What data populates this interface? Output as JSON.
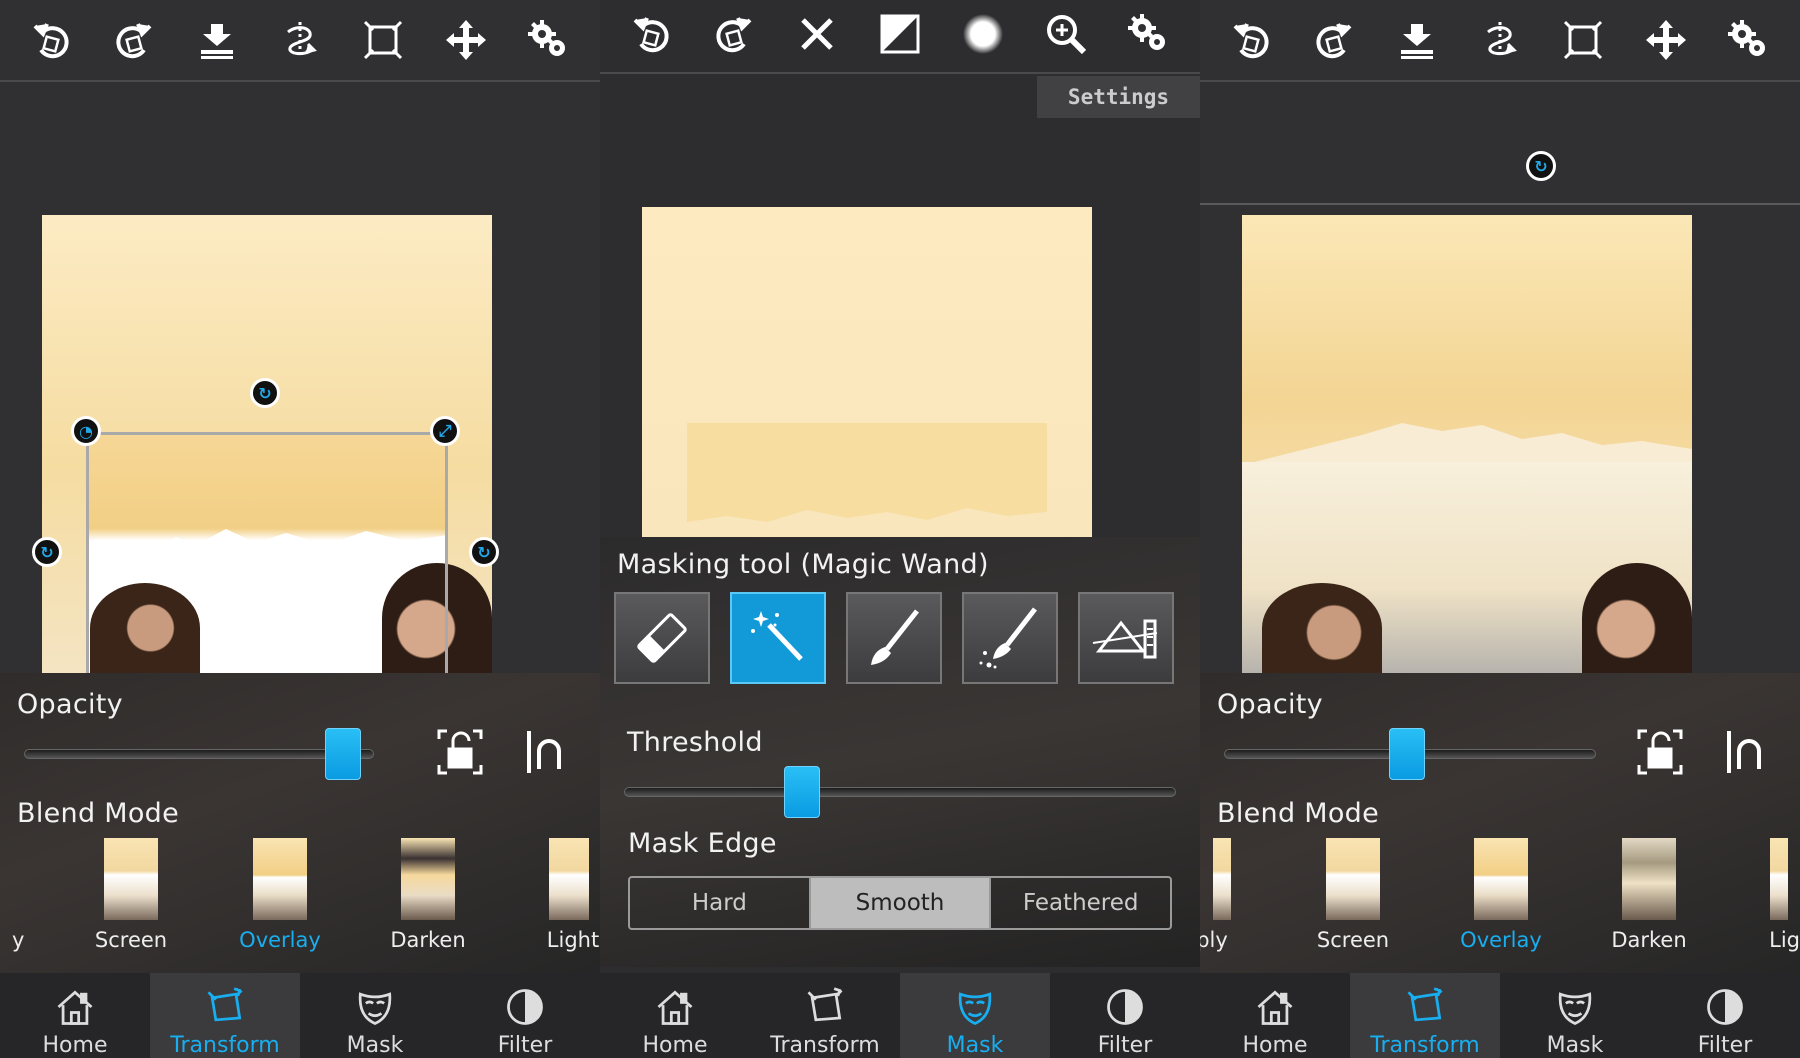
{
  "left": {
    "toolbar": [
      "undo-icon",
      "redo-icon",
      "merge-down-icon",
      "flip-icon",
      "fit-frame-icon",
      "move-icon",
      "settings-icon"
    ],
    "opacity": {
      "label": "Opacity",
      "value": 0.96
    },
    "blend": {
      "label": "Blend Mode",
      "items": [
        {
          "label": "y"
        },
        {
          "label": "Screen"
        },
        {
          "label": "Overlay",
          "selected": true
        },
        {
          "label": "Darken"
        },
        {
          "label": "Light"
        }
      ]
    },
    "tabs": [
      {
        "label": "Home"
      },
      {
        "label": "Transform",
        "active": true
      },
      {
        "label": "Mask"
      },
      {
        "label": "Filter"
      }
    ]
  },
  "middle": {
    "toolbar": [
      "undo-icon",
      "redo-icon",
      "clear-mask-icon",
      "invert-mask-icon",
      "brush-softness-icon",
      "zoom-icon",
      "settings-icon"
    ],
    "settings_label": "Settings",
    "masking_tool_title": "Masking tool (Magic Wand)",
    "tools": [
      "eraser-tool",
      "magic-wand-tool",
      "brush-tool",
      "spray-brush-tool",
      "gradient-tool"
    ],
    "active_tool": "magic-wand-tool",
    "threshold": {
      "label": "Threshold",
      "value": 0.31
    },
    "mask_edge": {
      "label": "Mask Edge",
      "options": [
        "Hard",
        "Smooth",
        "Feathered"
      ],
      "selected": "Smooth"
    },
    "tabs": [
      {
        "label": "Home"
      },
      {
        "label": "Transform"
      },
      {
        "label": "Mask",
        "active": true
      },
      {
        "label": "Filter"
      }
    ]
  },
  "right": {
    "toolbar": [
      "undo-icon",
      "redo-icon",
      "merge-down-icon",
      "flip-icon",
      "fit-frame-icon",
      "move-icon",
      "settings-icon"
    ],
    "opacity": {
      "label": "Opacity",
      "value": 0.49
    },
    "blend": {
      "label": "Blend Mode",
      "items": [
        {
          "label": "ply"
        },
        {
          "label": "Screen"
        },
        {
          "label": "Overlay",
          "selected": true
        },
        {
          "label": "Darken"
        },
        {
          "label": "Lig"
        }
      ]
    },
    "tabs": [
      {
        "label": "Home"
      },
      {
        "label": "Transform",
        "active": true
      },
      {
        "label": "Mask"
      },
      {
        "label": "Filter"
      }
    ]
  },
  "colors": {
    "accent": "#18aef0",
    "background": "#303032",
    "photo": "#f5dca1"
  }
}
